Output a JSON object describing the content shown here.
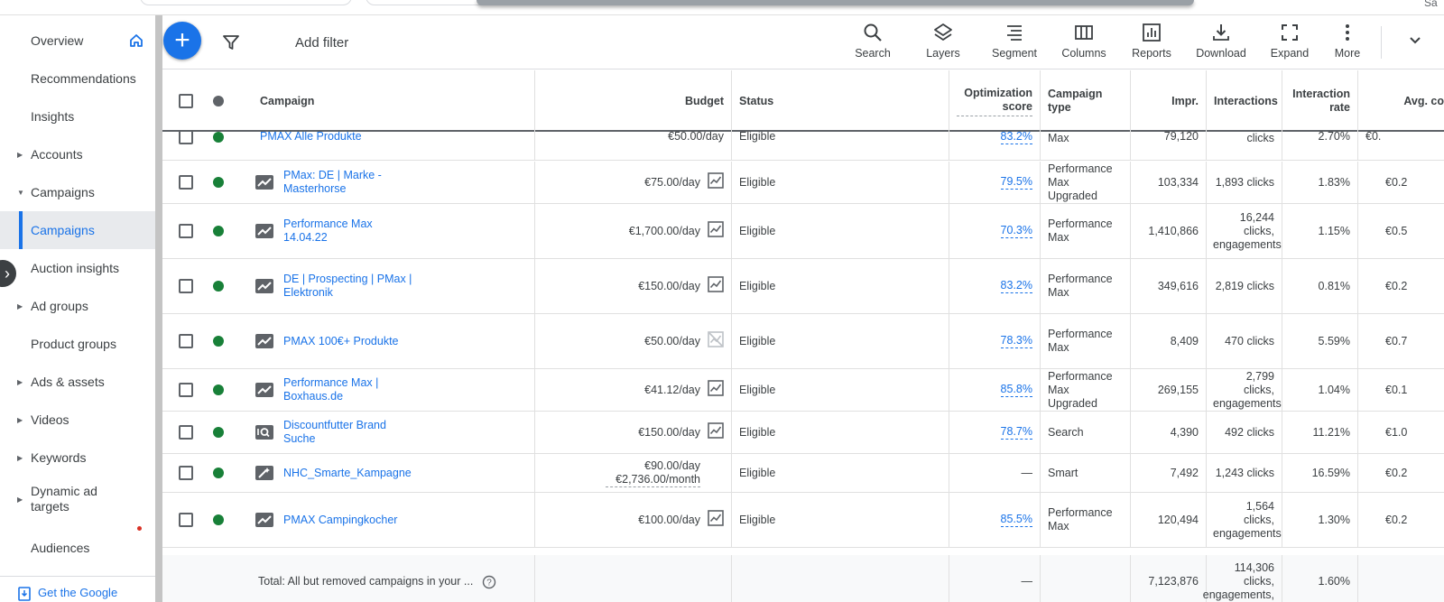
{
  "topbar": {
    "corner_text": "Sa"
  },
  "sidebar": {
    "items": [
      {
        "label": "Overview",
        "expandable": false
      },
      {
        "label": "Recommendations",
        "expandable": false
      },
      {
        "label": "Insights",
        "expandable": false
      },
      {
        "label": "Accounts",
        "expandable": true
      },
      {
        "label": "Campaigns",
        "expandable": true,
        "expanded": true
      },
      {
        "label": "Campaigns",
        "expandable": false,
        "selected": true
      },
      {
        "label": "Auction insights",
        "expandable": false
      },
      {
        "label": "Ad groups",
        "expandable": true
      },
      {
        "label": "Product groups",
        "expandable": false
      },
      {
        "label": "Ads & assets",
        "expandable": true
      },
      {
        "label": "Videos",
        "expandable": true
      },
      {
        "label": "Keywords",
        "expandable": true
      },
      {
        "label": "Dynamic ad targets",
        "expandable": true
      },
      {
        "label": "Audiences",
        "expandable": false
      }
    ],
    "promo": "Get the Google"
  },
  "toolbar": {
    "add_filter": "Add filter",
    "tools": [
      "Search",
      "Layers",
      "Segment",
      "Columns",
      "Reports",
      "Download",
      "Expand",
      "More"
    ]
  },
  "table": {
    "headers": {
      "campaign": "Campaign",
      "budget": "Budget",
      "status": "Status",
      "opt_score": "Optimization score",
      "campaign_type": "Campaign type",
      "impr": "Impr.",
      "interactions": "Interactions",
      "interaction_rate": "Interaction rate",
      "avg_cost": "Avg. co"
    },
    "partial_row": {
      "name": "PMAX Alle Produkte",
      "budget": "€50.00/day",
      "status": "Eligible",
      "opt_score": "83.2%",
      "type": "Max",
      "impr": "79,120",
      "interactions": "clicks",
      "rate": "2.70%",
      "avg": "€0."
    },
    "rows": [
      {
        "name": "PMax: DE | Marke - Masterhorse",
        "budget": "€75.00/day",
        "status": "Eligible",
        "opt_score": "79.5%",
        "type": "Performance Max Upgraded",
        "impr": "103,334",
        "interactions": "1,893 clicks",
        "rate": "1.83%",
        "avg": "€0.2",
        "icon": "pmax",
        "chart": "line"
      },
      {
        "name": "Performance Max  14.04.22",
        "budget": "€1,700.00/day",
        "status": "Eligible",
        "opt_score": "70.3%",
        "type": "Performance Max",
        "impr": "1,410,866",
        "interactions": "16,244 clicks, engagements",
        "rate": "1.15%",
        "avg": "€0.5",
        "icon": "pmax",
        "chart": "line"
      },
      {
        "name": "DE | Prospecting | PMax | Elektronik",
        "budget": "€150.00/day",
        "status": "Eligible",
        "opt_score": "83.2%",
        "type": "Performance Max",
        "impr": "349,616",
        "interactions": "2,819 clicks",
        "rate": "0.81%",
        "avg": "€0.2",
        "icon": "pmax",
        "chart": "line"
      },
      {
        "name": "PMAX 100€+ Produkte",
        "budget": "€50.00/day",
        "status": "Eligible",
        "opt_score": "78.3%",
        "type": "Performance Max",
        "impr": "8,409",
        "interactions": "470 clicks",
        "rate": "5.59%",
        "avg": "€0.7",
        "icon": "pmax",
        "chart": "none"
      },
      {
        "name": "Performance Max | Boxhaus.de",
        "budget": "€41.12/day",
        "status": "Eligible",
        "opt_score": "85.8%",
        "type": "Performance Max Upgraded",
        "impr": "269,155",
        "interactions": "2,799 clicks, engagements",
        "rate": "1.04%",
        "avg": "€0.1",
        "icon": "pmax",
        "chart": "line"
      },
      {
        "name": "Discountfutter Brand Suche",
        "budget": "€150.00/day",
        "status": "Eligible",
        "opt_score": "78.7%",
        "type": "Search",
        "impr": "4,390",
        "interactions": "492 clicks",
        "rate": "11.21%",
        "avg": "€1.0",
        "icon": "search",
        "chart": "line"
      },
      {
        "name": "NHC_Smarte_Kampagne",
        "budget": "€90.00/day €2,736.00/month",
        "status": "Eligible",
        "opt_score": "—",
        "type": "Smart",
        "impr": "7,492",
        "interactions": "1,243 clicks",
        "rate": "16.59%",
        "avg": "€0.2",
        "icon": "smart",
        "chart": "nochart"
      },
      {
        "name": "PMAX Campingkocher",
        "budget": "€100.00/day",
        "status": "Eligible",
        "opt_score": "85.5%",
        "type": "Performance Max",
        "impr": "120,494",
        "interactions": "1,564 clicks, engagements",
        "rate": "1.30%",
        "avg": "€0.2",
        "icon": "pmax",
        "chart": "line"
      }
    ],
    "total": {
      "label": "Total: All but removed campaigns in your ...",
      "opt_score": "—",
      "impr": "7,123,876",
      "interactions": "114,306 clicks, engagements,",
      "rate": "1.60%"
    }
  },
  "colors": {
    "accent": "#1a73e8",
    "status_green": "#188038",
    "text": "#3c4043",
    "grid": "#e0e0e0"
  }
}
